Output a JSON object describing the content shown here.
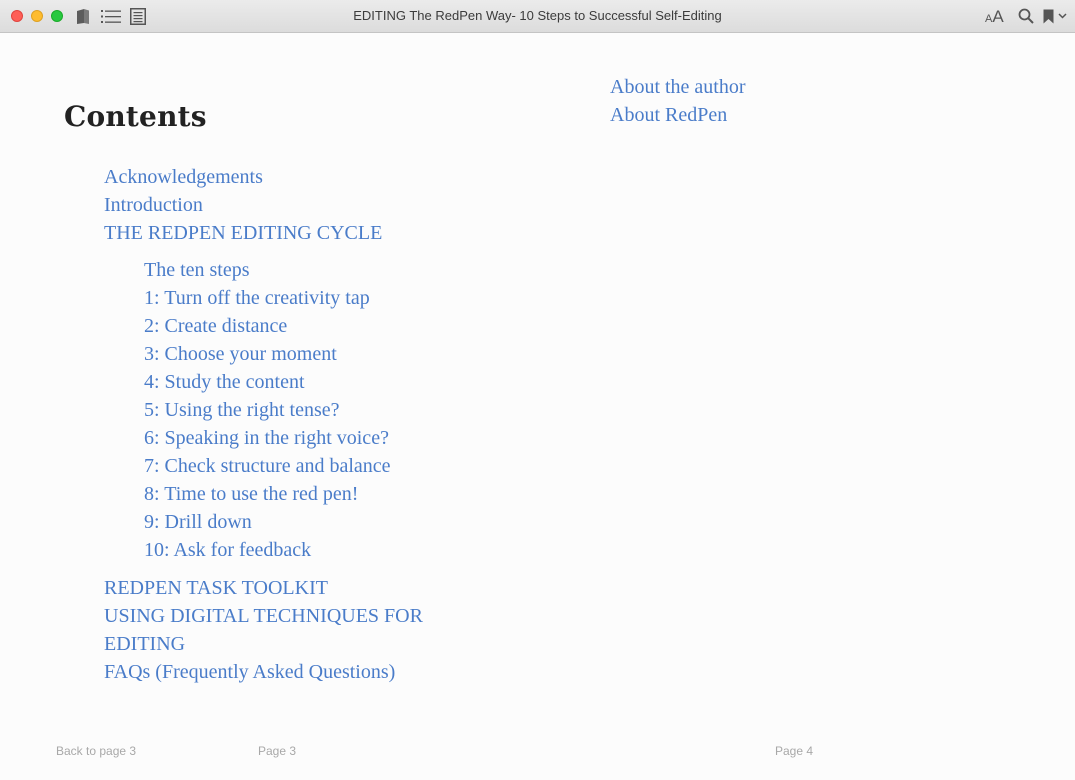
{
  "window": {
    "title": "EDITING The RedPen Way- 10 Steps to Successful Self-Editing",
    "font_size_small": "A",
    "font_size_large": "A",
    "icons": [
      "library-icon",
      "table-of-contents-icon",
      "notes-icon",
      "search-icon",
      "bookmark-icon",
      "chevron-down-icon"
    ]
  },
  "left_page": {
    "heading": "Contents",
    "top_items": [
      "Acknowledgements",
      "Introduction",
      "THE REDPEN EDITING CYCLE"
    ],
    "sub_items": [
      "The ten steps",
      "1: Turn off the creativity tap",
      "2: Create distance",
      "3: Choose your moment",
      "4: Study the content",
      "5: Using the right tense?",
      "6: Speaking in the right voice?",
      "7: Check structure and balance",
      "8: Time to use the red pen!",
      "9: Drill down",
      "10: Ask for feedback"
    ],
    "bottom_items": [
      "REDPEN TASK TOOLKIT",
      "USING DIGITAL TECHNIQUES FOR",
      "EDITING",
      "FAQs (Frequently Asked Questions)"
    ]
  },
  "right_page": {
    "items": [
      "About the author",
      "About RedPen"
    ]
  },
  "footer": {
    "back_link": "Back to page 3",
    "left_page_number": "Page 3",
    "right_page_number": "Page 4"
  },
  "colors": {
    "link": "#4a7cc9",
    "heading": "#222222",
    "background": "#fcfcfc"
  }
}
